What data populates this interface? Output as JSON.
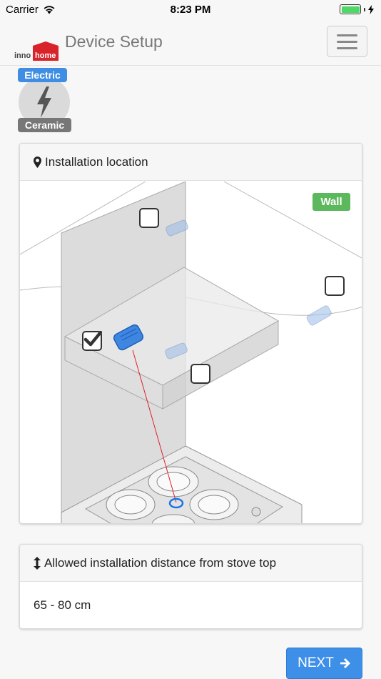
{
  "status_bar": {
    "carrier": "Carrier",
    "time": "8:23 PM"
  },
  "navbar": {
    "logo_top": "inno",
    "logo_bottom": "home",
    "title": "Device Setup",
    "menu_icon": "hamburger-icon"
  },
  "stove_type": {
    "energy_label": "Electric",
    "surface_label": "Ceramic",
    "icon": "lightning-bolt-icon"
  },
  "installation_location": {
    "header": "Installation location",
    "header_icon": "map-marker-icon",
    "wall_label": "Wall",
    "options": [
      {
        "id": "wall-top",
        "checked": false
      },
      {
        "id": "wall-right",
        "checked": false
      },
      {
        "id": "hood-left",
        "checked": true
      },
      {
        "id": "hood-right",
        "checked": false
      }
    ]
  },
  "installation_distance": {
    "header": "Allowed installation distance from stove top",
    "header_icon": "vertical-arrows-icon",
    "value": "65 - 80 cm"
  },
  "next_button": {
    "label": "NEXT",
    "icon": "arrow-right-icon"
  },
  "colors": {
    "accent": "#3e8fe8",
    "electric_badge": "#3f8ee4",
    "ceramic_badge": "#777777",
    "wall_badge": "#5cb85c",
    "battery": "#4cd964",
    "laser_line": "#e0202a"
  }
}
